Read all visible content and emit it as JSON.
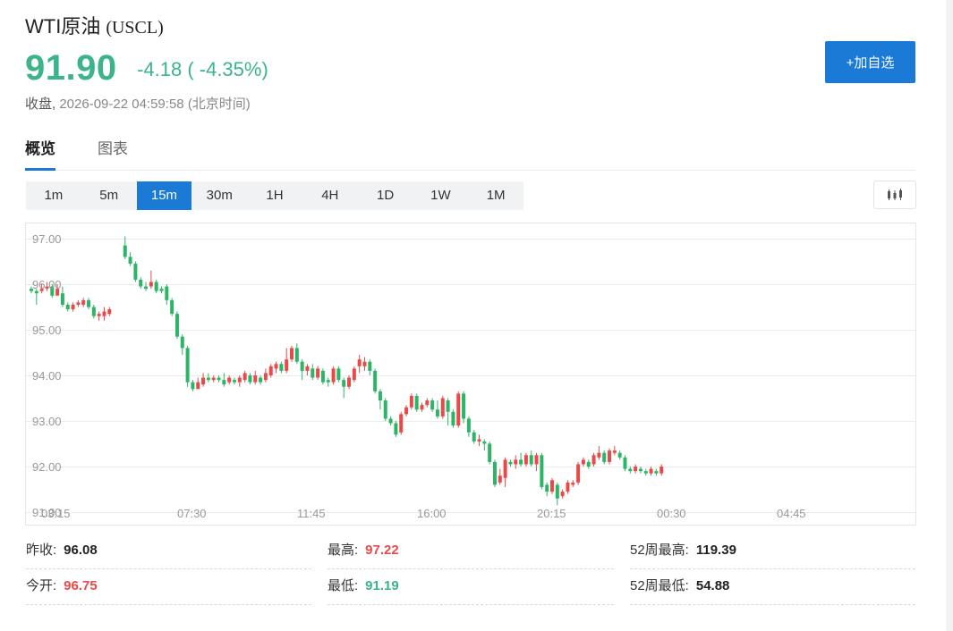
{
  "header": {
    "name": "WTI原油",
    "code": "(USCL)",
    "price": "91.90",
    "change": "-4.18 ( -4.35%)",
    "status_label": "收盘,",
    "timestamp": "2026-09-22 04:59:58",
    "tz_note": "(北京时间)",
    "add_button": "+加自选",
    "price_color": "#3cb48a"
  },
  "tabs": [
    {
      "label": "概览",
      "active": true
    },
    {
      "label": "图表",
      "active": false
    }
  ],
  "periods": [
    "1m",
    "5m",
    "15m",
    "30m",
    "1H",
    "4H",
    "1D",
    "1W",
    "1M"
  ],
  "active_period": "15m",
  "chart_type_icon": "candlestick-chart-icon",
  "stats": {
    "prev_close": {
      "label": "昨收:",
      "value": "96.08"
    },
    "open": {
      "label": "今开:",
      "value": "96.75"
    },
    "high": {
      "label": "最高:",
      "value": "97.22"
    },
    "low": {
      "label": "最低:",
      "value": "91.19"
    },
    "w52_high": {
      "label": "52周最高:",
      "value": "119.39"
    },
    "w52_low": {
      "label": "52周最低:",
      "value": "54.88"
    }
  },
  "colors": {
    "up": "#e84a4a",
    "down": "#2db567",
    "accent": "#1a7ad6"
  },
  "chart_data": {
    "type": "candlestick",
    "y_ticks": [
      "97.00",
      "96.00",
      "95.00",
      "94.00",
      "93.00",
      "92.00",
      "91.00"
    ],
    "ylim": [
      91.0,
      97.3
    ],
    "x_ticks": [
      "03:15",
      "07:30",
      "11:45",
      "16:00",
      "20:15",
      "00:30",
      "04:45"
    ],
    "grid": true,
    "candles": [
      [
        95.9,
        95.85,
        95.95,
        95.8
      ],
      [
        95.85,
        95.8,
        95.9,
        95.55
      ],
      [
        95.85,
        95.9,
        96.0,
        95.8
      ],
      [
        95.9,
        95.95,
        96.05,
        95.85
      ],
      [
        95.95,
        95.75,
        96.0,
        95.7
      ],
      [
        95.75,
        95.9,
        96.0,
        95.75
      ],
      [
        95.8,
        95.55,
        95.95,
        95.5
      ],
      [
        95.55,
        95.45,
        95.6,
        95.4
      ],
      [
        95.45,
        95.55,
        95.6,
        95.4
      ],
      [
        95.55,
        95.6,
        95.65,
        95.5
      ],
      [
        95.55,
        95.65,
        95.7,
        95.5
      ],
      [
        95.65,
        95.5,
        95.7,
        95.45
      ],
      [
        95.5,
        95.3,
        95.55,
        95.25
      ],
      [
        95.3,
        95.35,
        95.4,
        95.2
      ],
      [
        95.3,
        95.4,
        95.5,
        95.2
      ],
      [
        95.35,
        95.45,
        95.5,
        95.3
      ],
      null,
      null,
      [
        96.85,
        96.6,
        97.05,
        96.55
      ],
      [
        96.6,
        96.45,
        96.7,
        96.4
      ],
      [
        96.45,
        96.1,
        96.5,
        96.05
      ],
      [
        96.1,
        95.95,
        96.15,
        95.9
      ],
      [
        95.95,
        95.9,
        96.05,
        95.85
      ],
      [
        95.95,
        96.05,
        96.3,
        95.9
      ],
      [
        96.05,
        95.85,
        96.1,
        95.8
      ],
      [
        95.9,
        95.85,
        95.95,
        95.8
      ],
      [
        95.95,
        95.65,
        96.0,
        95.55
      ],
      [
        95.65,
        95.35,
        95.7,
        95.3
      ],
      [
        95.35,
        94.85,
        95.4,
        94.8
      ],
      [
        94.85,
        94.6,
        94.9,
        94.45
      ],
      [
        94.6,
        93.85,
        94.65,
        93.75
      ],
      [
        93.85,
        93.7,
        93.9,
        93.65
      ],
      [
        93.7,
        93.85,
        93.95,
        93.75
      ],
      [
        93.8,
        93.95,
        94.05,
        93.75
      ],
      [
        93.95,
        93.9,
        94.05,
        93.85
      ],
      [
        93.9,
        93.95,
        94.0,
        93.85
      ],
      [
        93.95,
        93.9,
        94.0,
        93.85
      ],
      [
        93.9,
        93.8,
        94.05,
        93.75
      ],
      [
        93.85,
        93.95,
        94.0,
        93.8
      ],
      [
        93.9,
        93.85,
        93.95,
        93.8
      ],
      [
        93.85,
        93.95,
        94.0,
        93.75
      ],
      [
        93.9,
        94.05,
        94.1,
        93.85
      ],
      [
        94.0,
        93.85,
        94.05,
        93.8
      ],
      [
        93.85,
        94.0,
        94.1,
        93.8
      ],
      [
        93.95,
        93.85,
        94.0,
        93.8
      ],
      [
        93.9,
        94.05,
        94.15,
        93.85
      ],
      [
        94.0,
        94.2,
        94.25,
        93.95
      ],
      [
        94.15,
        94.25,
        94.3,
        94.05
      ],
      [
        94.25,
        94.1,
        94.3,
        94.05
      ],
      [
        94.1,
        94.35,
        94.6,
        94.05
      ],
      [
        94.35,
        94.6,
        94.65,
        94.3
      ],
      [
        94.6,
        94.3,
        94.7,
        94.25
      ],
      [
        94.3,
        94.1,
        94.35,
        93.9
      ],
      [
        94.1,
        94.2,
        94.25,
        94.0
      ],
      [
        94.15,
        93.95,
        94.25,
        93.9
      ],
      [
        93.95,
        94.15,
        94.2,
        93.9
      ],
      [
        94.1,
        93.85,
        94.15,
        93.8
      ],
      [
        93.9,
        93.85,
        93.95,
        93.75
      ],
      [
        93.85,
        94.15,
        94.2,
        93.8
      ],
      [
        94.15,
        93.9,
        94.2,
        93.85
      ],
      [
        93.9,
        93.75,
        93.95,
        93.5
      ],
      [
        93.75,
        93.95,
        94.0,
        93.7
      ],
      [
        93.9,
        94.15,
        94.2,
        93.85
      ],
      [
        94.2,
        94.35,
        94.45,
        94.05
      ],
      [
        94.2,
        94.3,
        94.4,
        94.1
      ],
      [
        94.3,
        94.1,
        94.35,
        94.0
      ],
      [
        94.1,
        93.65,
        94.15,
        93.6
      ],
      [
        93.65,
        93.45,
        93.7,
        93.25
      ],
      [
        93.45,
        93.05,
        93.5,
        93.0
      ],
      [
        93.05,
        92.95,
        93.1,
        92.9
      ],
      [
        92.95,
        92.7,
        93.0,
        92.65
      ],
      [
        92.75,
        93.15,
        93.2,
        92.7
      ],
      [
        93.15,
        93.3,
        93.35,
        93.1
      ],
      [
        93.3,
        93.55,
        93.6,
        93.25
      ],
      [
        93.55,
        93.25,
        93.6,
        93.2
      ],
      [
        93.25,
        93.35,
        93.4,
        93.2
      ],
      [
        93.35,
        93.45,
        93.5,
        93.3
      ],
      [
        93.45,
        93.25,
        93.5,
        93.2
      ],
      [
        93.25,
        93.1,
        93.45,
        93.05
      ],
      [
        93.1,
        93.5,
        93.55,
        93.05
      ],
      [
        93.45,
        93.2,
        93.5,
        92.9
      ],
      [
        93.2,
        92.9,
        93.25,
        92.85
      ],
      [
        92.9,
        93.6,
        93.65,
        92.85
      ],
      [
        93.6,
        93.05,
        93.65,
        92.95
      ],
      [
        93.05,
        92.75,
        93.1,
        92.65
      ],
      [
        92.75,
        92.55,
        92.8,
        92.5
      ],
      [
        92.55,
        92.6,
        92.7,
        92.45
      ],
      [
        92.55,
        92.5,
        92.6,
        92.35
      ],
      [
        92.5,
        92.1,
        92.55,
        92.05
      ],
      [
        92.1,
        91.6,
        92.15,
        91.55
      ],
      [
        91.65,
        91.8,
        91.95,
        91.6
      ],
      [
        91.75,
        92.15,
        92.2,
        91.55
      ],
      [
        92.1,
        92.05,
        92.15,
        92.0
      ],
      [
        92.05,
        92.15,
        92.25,
        91.95
      ],
      [
        92.15,
        92.05,
        92.3,
        92.0
      ],
      [
        92.05,
        92.25,
        92.3,
        92.0
      ],
      [
        92.25,
        92.05,
        92.35,
        92.0
      ],
      [
        92.05,
        92.25,
        92.3,
        91.9
      ],
      [
        92.25,
        91.55,
        92.3,
        91.5
      ],
      [
        91.6,
        91.45,
        91.65,
        91.35
      ],
      [
        91.45,
        91.7,
        91.75,
        91.4
      ],
      [
        91.6,
        91.3,
        91.65,
        91.15
      ],
      [
        91.35,
        91.45,
        91.5,
        91.3
      ],
      [
        91.45,
        91.65,
        91.7,
        91.4
      ],
      [
        91.6,
        91.65,
        91.7,
        91.55
      ],
      [
        91.65,
        92.05,
        92.1,
        91.6
      ],
      [
        92.05,
        92.15,
        92.2,
        92.0
      ],
      [
        92.1,
        92.0,
        92.15,
        91.95
      ],
      [
        92.05,
        92.25,
        92.3,
        92.0
      ],
      [
        92.2,
        92.3,
        92.45,
        92.15
      ],
      [
        92.3,
        92.1,
        92.35,
        92.05
      ],
      [
        92.1,
        92.35,
        92.4,
        92.05
      ],
      [
        92.3,
        92.35,
        92.45,
        92.25
      ],
      [
        92.3,
        92.2,
        92.35,
        92.15
      ],
      [
        92.2,
        91.95,
        92.25,
        91.9
      ],
      [
        91.95,
        91.9,
        92.0,
        91.85
      ],
      [
        91.9,
        92.0,
        92.05,
        91.85
      ],
      [
        91.95,
        91.9,
        92.0,
        91.85
      ],
      [
        91.9,
        91.85,
        91.95,
        91.8
      ],
      [
        91.85,
        91.95,
        92.0,
        91.8
      ],
      [
        91.9,
        91.85,
        91.95,
        91.8
      ],
      [
        91.85,
        92.0,
        92.05,
        91.8
      ]
    ]
  }
}
